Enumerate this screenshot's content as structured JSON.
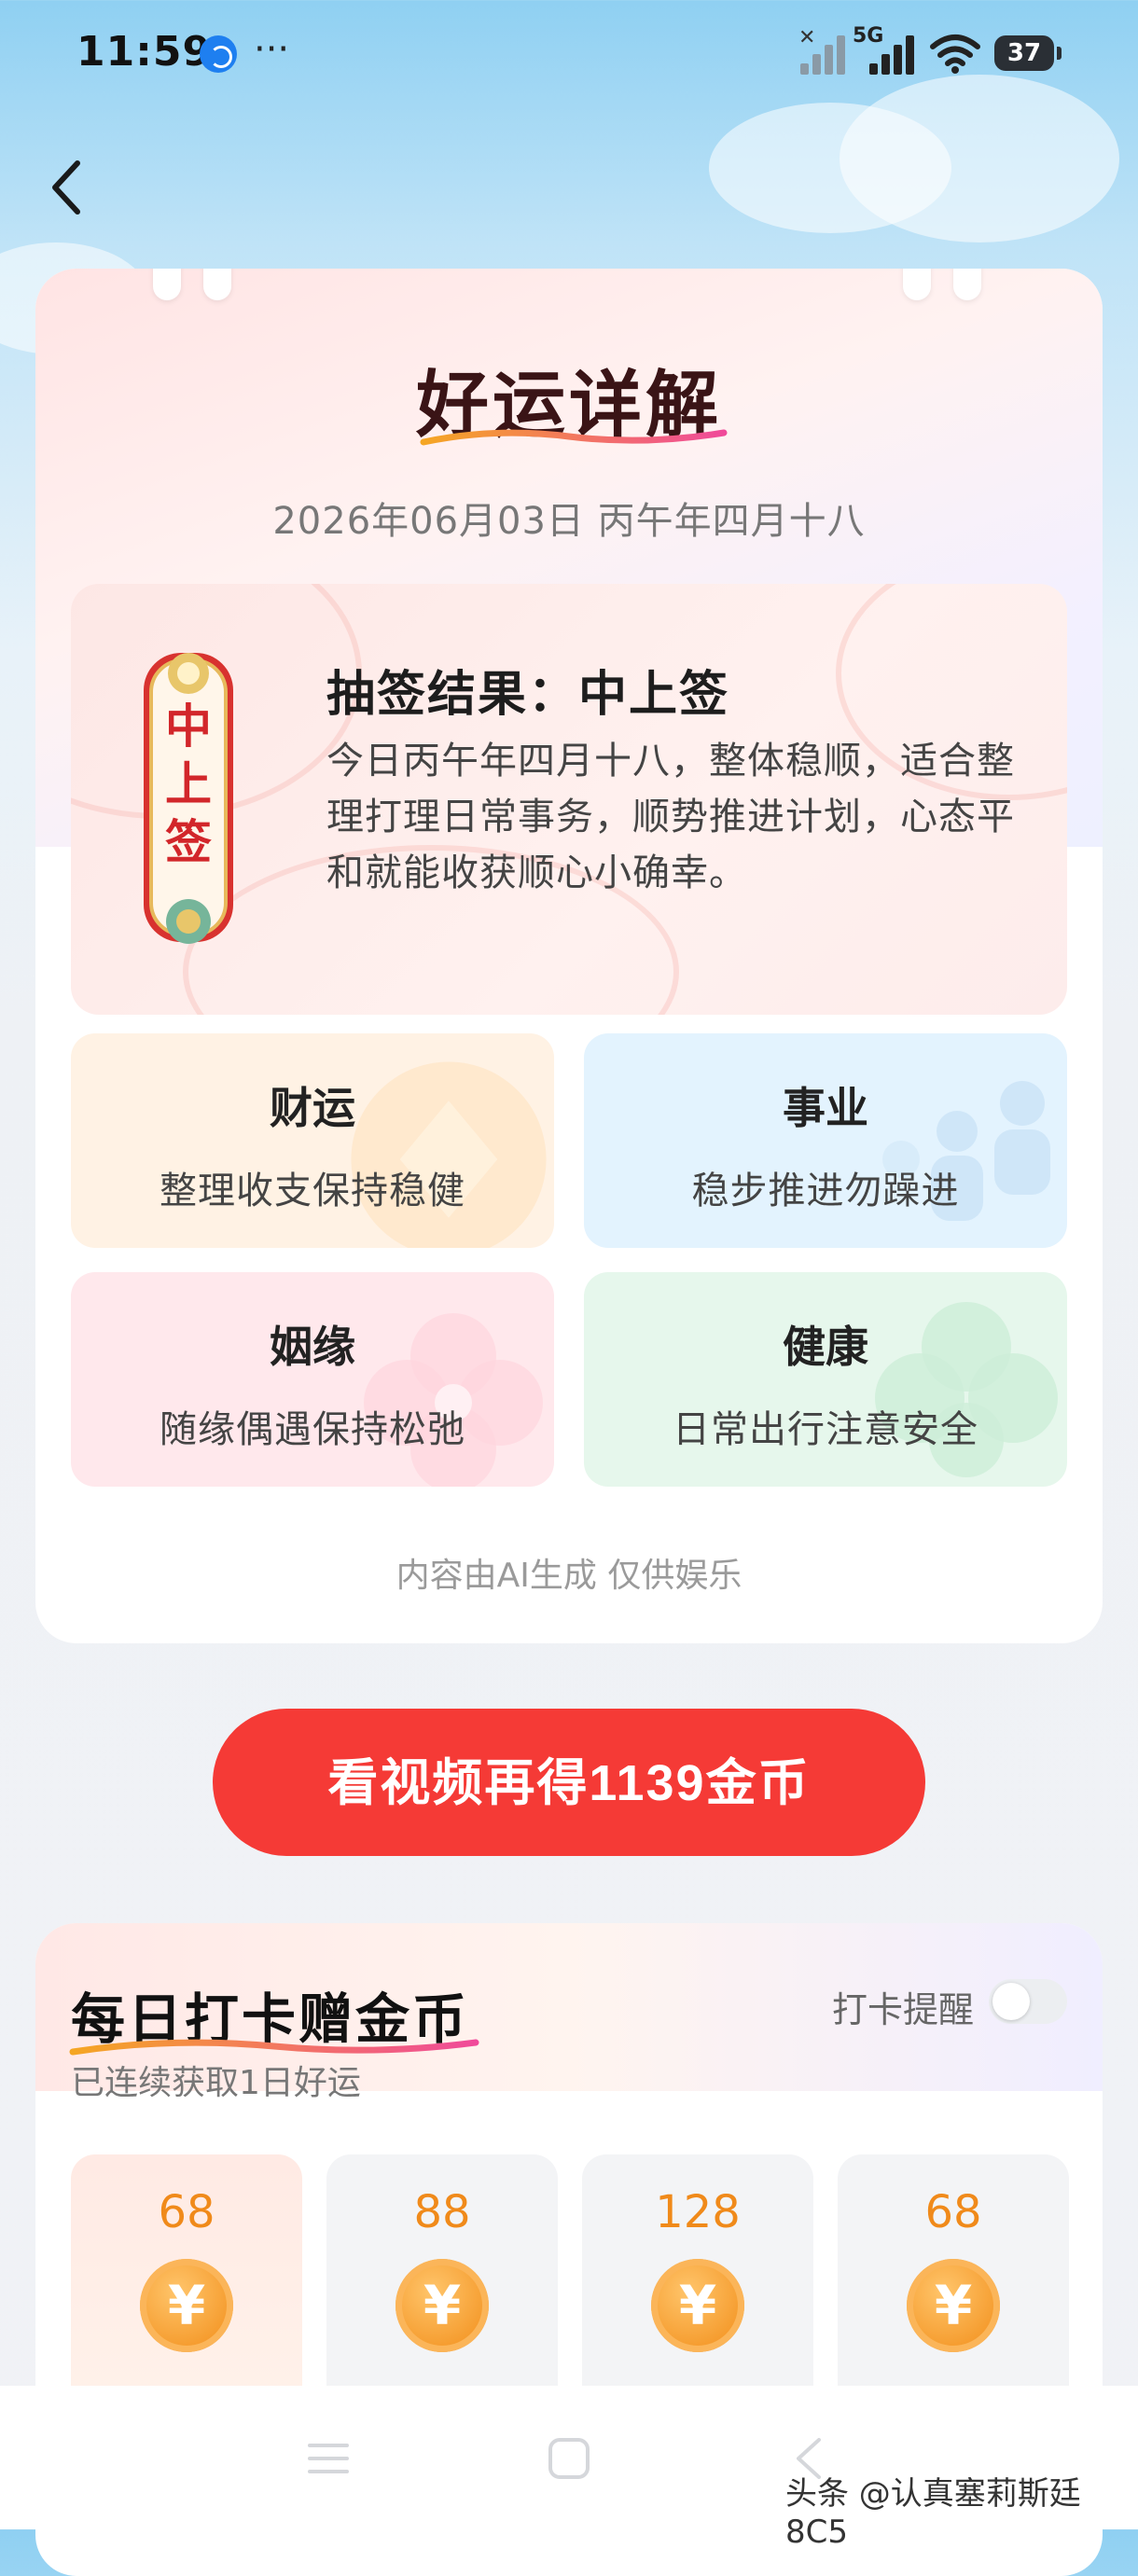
{
  "status_bar": {
    "time": "11:59",
    "dots": "···",
    "network": "5G",
    "battery": "37"
  },
  "header": {
    "title": "好运详解",
    "date": "2026年06月03日  丙午年四月十八"
  },
  "lot": {
    "tag_text": "中上签",
    "result": "抽签结果：中上签",
    "description": "今日丙午年四月十八，整体稳顺，适合整理打理日常事务，顺势推进计划，心态平和就能收获顺心小确幸。"
  },
  "fortunes": [
    {
      "title": "财运",
      "desc": "整理收支保持稳健"
    },
    {
      "title": "事业",
      "desc": "稳步推进勿躁进"
    },
    {
      "title": "姻缘",
      "desc": "随缘偶遇保持松弛"
    },
    {
      "title": "健康",
      "desc": "日常出行注意安全"
    }
  ],
  "disclaimer": "内容由AI生成 仅供娱乐",
  "cta": {
    "label": "看视频再得1139金币"
  },
  "checkin": {
    "title": "每日打卡赠金币",
    "subtitle": "已连续获取1日好运",
    "reminder_label": "打卡提醒",
    "reminder_on": false,
    "days": [
      {
        "amount": "68",
        "coin": "¥"
      },
      {
        "amount": "88",
        "coin": "¥"
      },
      {
        "amount": "128",
        "coin": "¥"
      },
      {
        "amount": "68",
        "coin": "¥"
      }
    ]
  },
  "watermark": "头条 @认真塞莉斯廷8C5",
  "colors": {
    "accent_red": "#f53a36",
    "coin_orange": "#f59b2d",
    "tag_red": "#d2262a"
  }
}
